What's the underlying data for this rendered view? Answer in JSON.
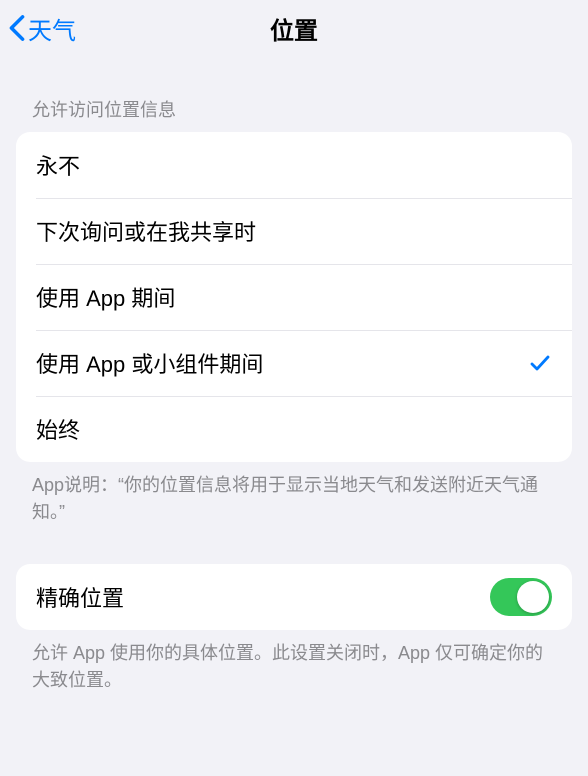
{
  "nav": {
    "back_label": "天气",
    "title": "位置"
  },
  "access_section": {
    "header": "允许访问位置信息",
    "options": [
      {
        "label": "永不",
        "selected": false
      },
      {
        "label": "下次询问或在我共享时",
        "selected": false
      },
      {
        "label": "使用 App 期间",
        "selected": false
      },
      {
        "label": "使用 App 或小组件期间",
        "selected": true
      },
      {
        "label": "始终",
        "selected": false
      }
    ],
    "footer": "App说明：“你的位置信息将用于显示当地天气和发送附近天气通知。”"
  },
  "precise_section": {
    "label": "精确位置",
    "enabled": true,
    "footer": "允许 App 使用你的具体位置。此设置关闭时，App 仅可确定你的大致位置。"
  }
}
